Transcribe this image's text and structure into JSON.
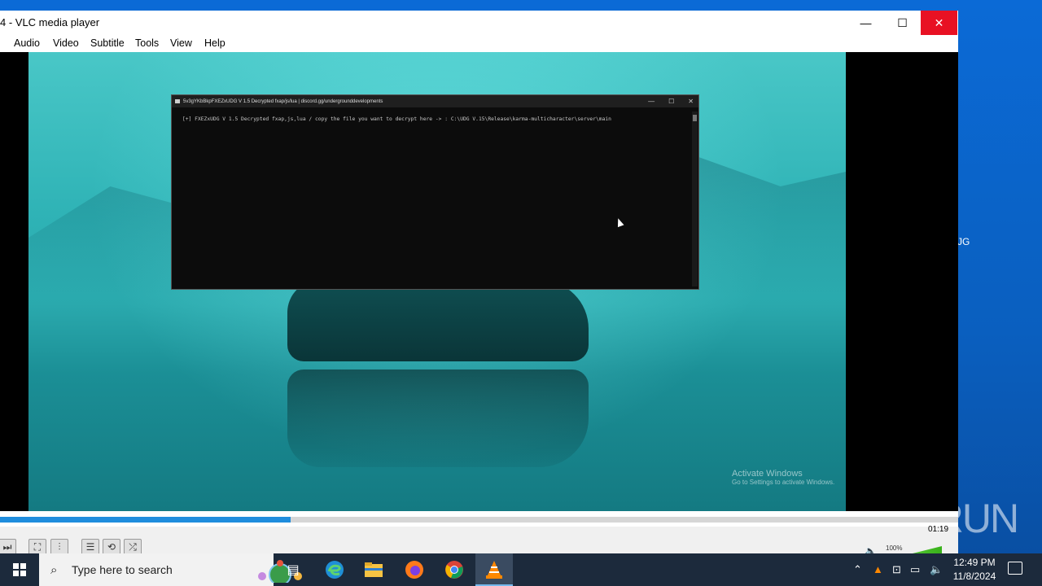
{
  "window": {
    "title": "4 - VLC media player",
    "minimize": "—",
    "maximize": "☐",
    "close": "✕"
  },
  "menu": [
    "Audio",
    "Video",
    "Subtitle",
    "Tools",
    "View",
    "Help"
  ],
  "console": {
    "title": "5v3gYKbBkpFXEZxUDG V 1.5 Decrypted fxap/js/lua | discord.gg/undergrounddevelopments",
    "line": "[+] FXEZxUDG V 1.5 Decrypted fxap,js,lua / copy the file you want to decrypt here -> : C:\\UDG V.15\\Release\\karma-multicharacter\\server\\main",
    "min": "—",
    "max": "☐",
    "close": "✕"
  },
  "watermark": {
    "line1": "Activate Windows",
    "line2": "Go to Settings to activate Windows."
  },
  "player": {
    "time": "01:19",
    "progress": 0.303,
    "volume": "100%"
  },
  "desktop": {
    "label_fragment": "JG",
    "brand": "ANY RUN"
  },
  "taskbar": {
    "search_placeholder": "Type here to search",
    "time": "12:49 PM",
    "date": "11/8/2024"
  },
  "icons": {
    "start": "windows-logo-icon",
    "search": "search-icon",
    "task_view": "task-view-icon",
    "edge": "edge-icon",
    "explorer": "file-explorer-icon",
    "firefox": "firefox-icon",
    "chrome": "chrome-icon",
    "vlc": "vlc-icon"
  }
}
